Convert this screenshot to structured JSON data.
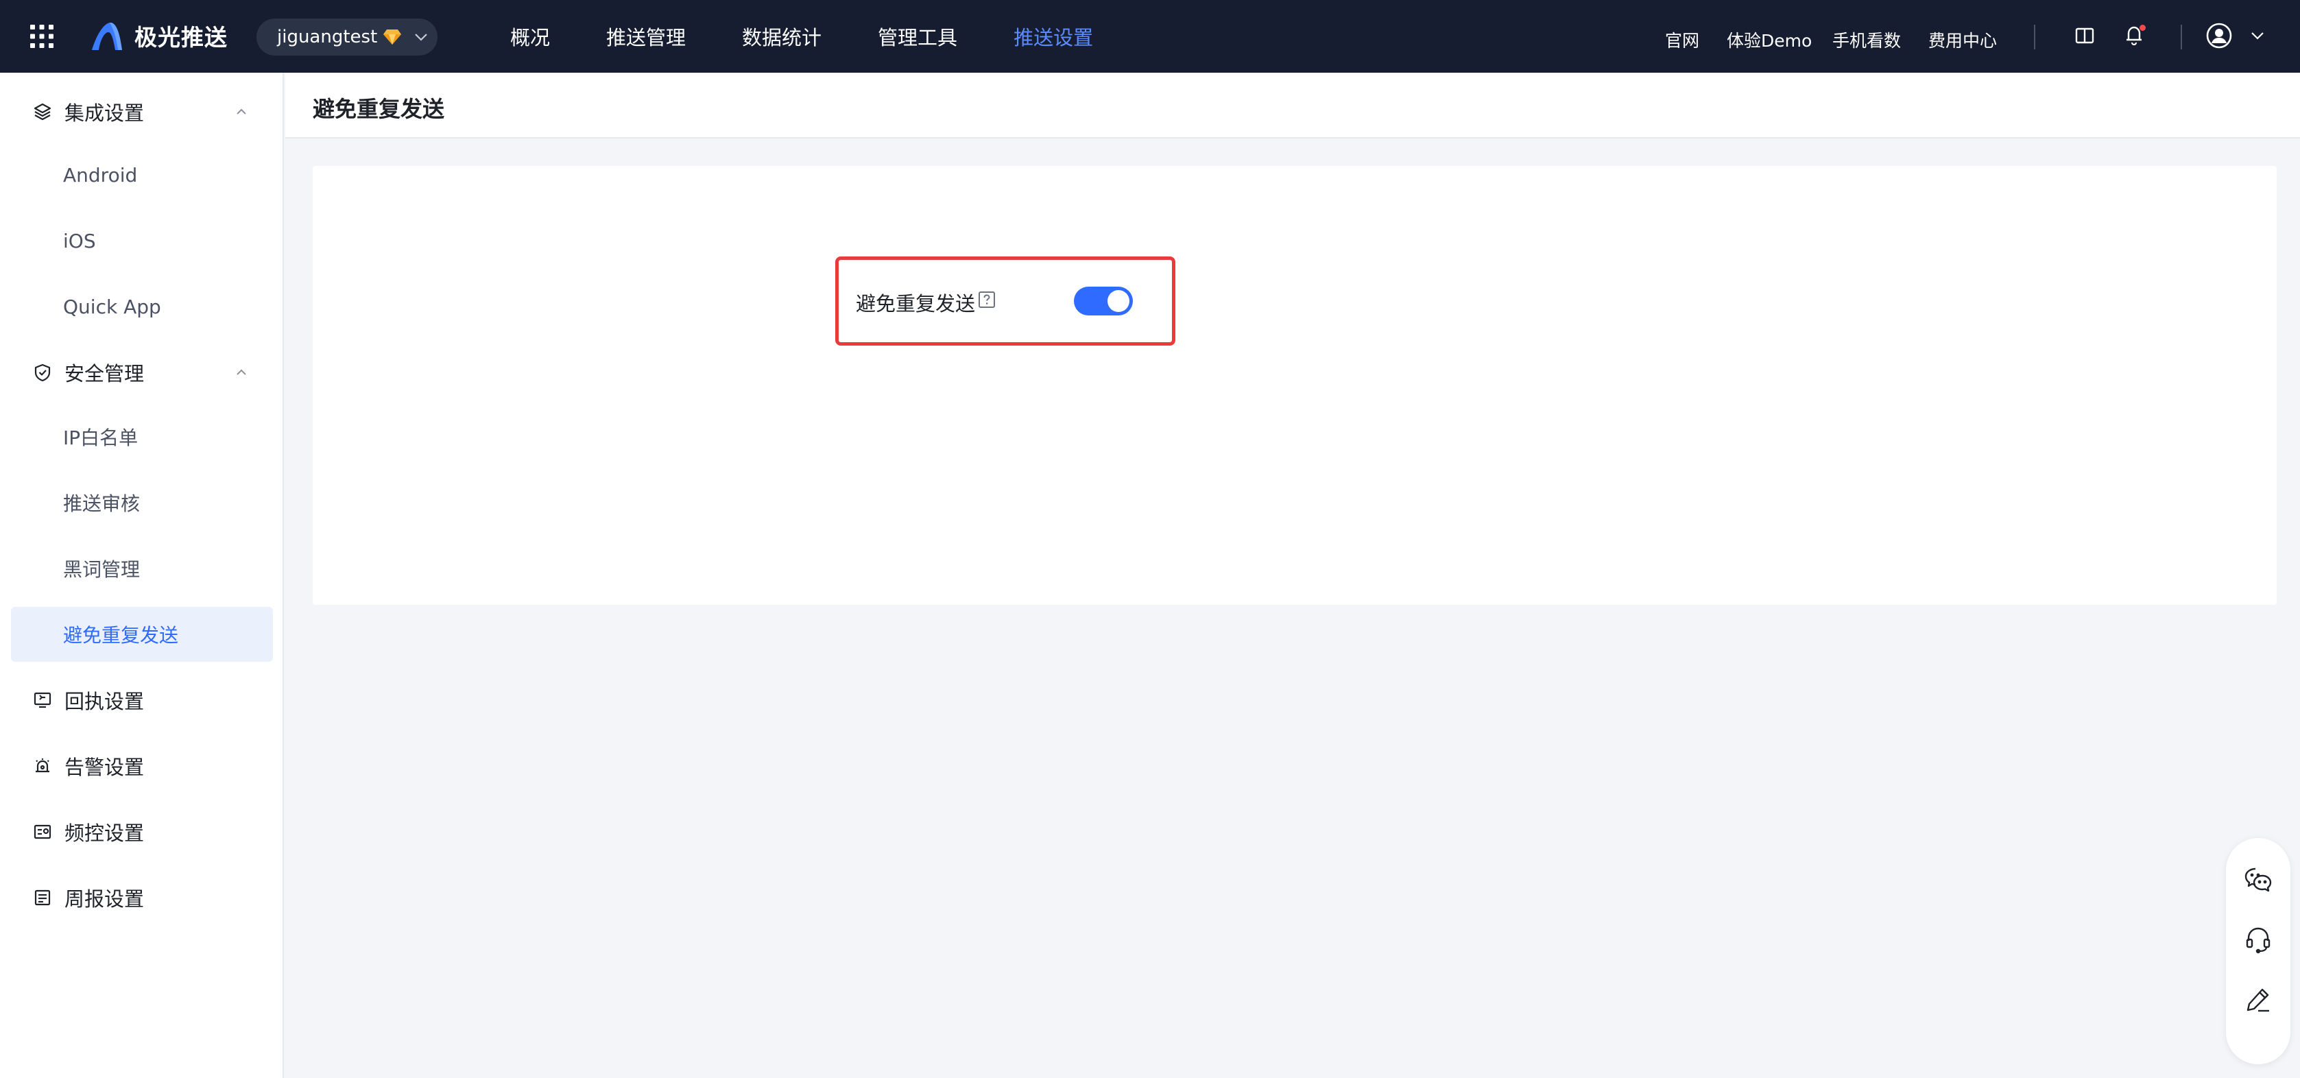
{
  "brand": {
    "name": "极光推送"
  },
  "app_switcher": {
    "app_name": "jiguangtest"
  },
  "main_nav": [
    {
      "label": "概况"
    },
    {
      "label": "推送管理"
    },
    {
      "label": "数据统计"
    },
    {
      "label": "管理工具"
    },
    {
      "label": "推送设置",
      "active": true
    }
  ],
  "top_links": [
    {
      "label": "官网"
    },
    {
      "label": "体验Demo"
    },
    {
      "label": "手机看数"
    },
    {
      "label": "费用中心"
    }
  ],
  "sidebar": {
    "groups": [
      {
        "label": "集成设置",
        "icon": "layers-icon",
        "expanded": true,
        "items": [
          {
            "label": "Android"
          },
          {
            "label": "iOS"
          },
          {
            "label": "Quick App"
          }
        ]
      },
      {
        "label": "安全管理",
        "icon": "shield-icon",
        "expanded": true,
        "items": [
          {
            "label": "IP白名单"
          },
          {
            "label": "推送审核"
          },
          {
            "label": "黑词管理"
          },
          {
            "label": "避免重复发送",
            "active": true
          }
        ]
      },
      {
        "label": "回执设置",
        "icon": "receipt-monitor-icon"
      },
      {
        "label": "告警设置",
        "icon": "alarm-icon"
      },
      {
        "label": "频控设置",
        "icon": "rate-control-icon"
      },
      {
        "label": "周报设置",
        "icon": "report-icon"
      }
    ]
  },
  "page": {
    "title": "避免重复发送",
    "setting": {
      "label": "避免重复发送",
      "enabled": true
    }
  },
  "floating_tools": [
    {
      "icon": "wechat-icon"
    },
    {
      "icon": "headset-icon"
    },
    {
      "icon": "edit-icon"
    }
  ],
  "colors": {
    "topbar_bg": "#161d30",
    "accent": "#2f6bff",
    "nav_active": "#5b8cff",
    "highlight": "#e83b3b"
  }
}
